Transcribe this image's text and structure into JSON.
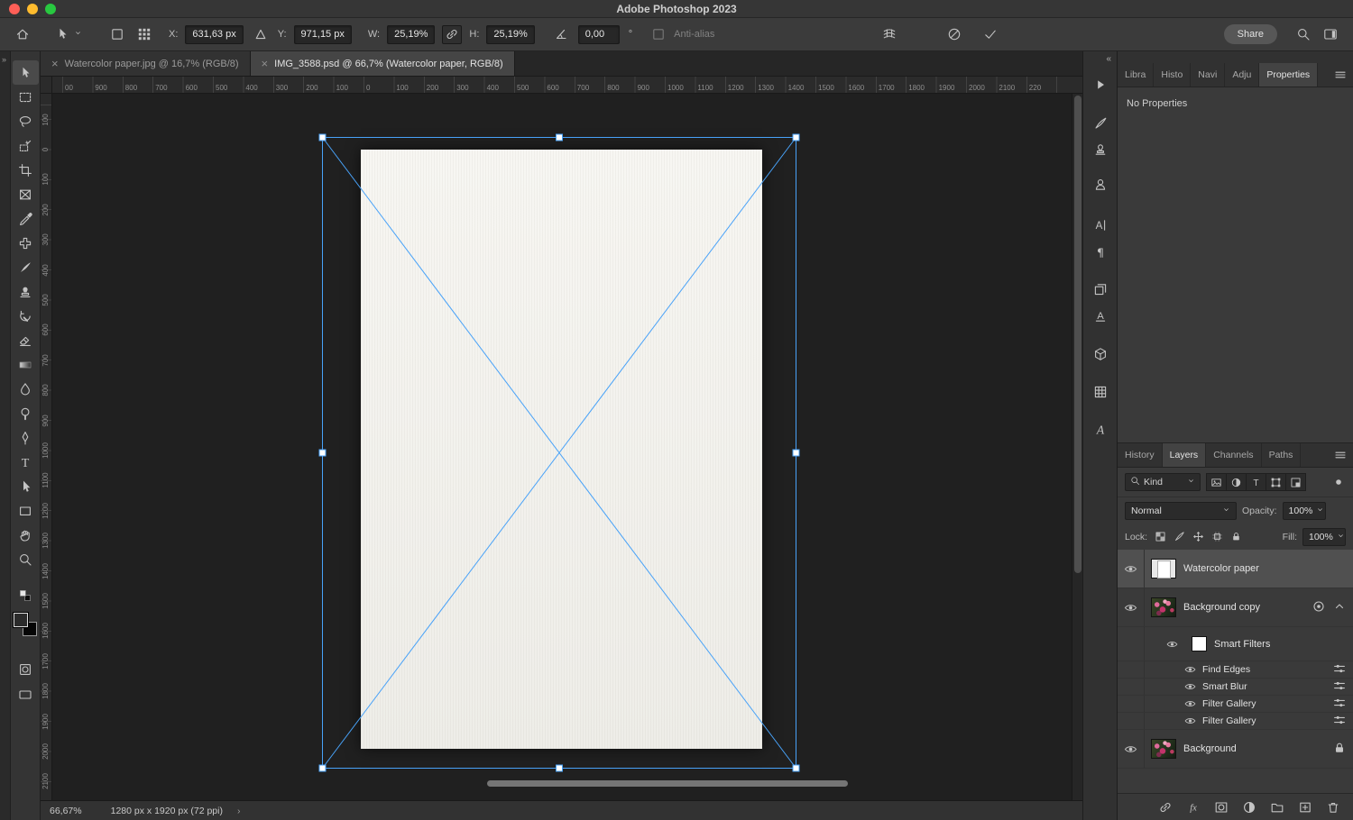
{
  "titlebar": {
    "title": "Adobe Photoshop 2023"
  },
  "colors": {
    "accent_blue": "#48a2f8",
    "traffic_red": "#ff5f57",
    "traffic_yellow": "#febc2e",
    "traffic_green": "#28c840",
    "selected_layer_bg": "#505050"
  },
  "options": {
    "fields": {
      "x_label": "X:",
      "x_value": "631,63 px",
      "y_label": "Y:",
      "y_value": "971,15 px",
      "w_label": "W:",
      "w_value": "25,19%",
      "h_label": "H:",
      "h_value": "25,19%",
      "angle_value": "0,00",
      "degree": "°"
    },
    "anti_alias_label": "Anti-alias",
    "share_label": "Share"
  },
  "doc_tabs": [
    {
      "label": "Watercolor paper.jpg @ 16,7% (RGB/8)",
      "active": false
    },
    {
      "label": "IMG_3588.psd @ 66,7% (Watercolor paper, RGB/8)",
      "active": true
    }
  ],
  "rulers": {
    "horizontal": [
      "00",
      "900",
      "800",
      "700",
      "600",
      "500",
      "400",
      "300",
      "200",
      "100",
      "0",
      "100",
      "200",
      "300",
      "400",
      "500",
      "600",
      "700",
      "800",
      "900",
      "1000",
      "1100",
      "1200",
      "1300",
      "1400",
      "1500",
      "1600",
      "1700",
      "1800",
      "1900",
      "2000",
      "2100",
      "220"
    ],
    "vertical": [
      "100",
      "0",
      "100",
      "200",
      "300",
      "400",
      "500",
      "600",
      "700",
      "800",
      "900",
      "1000",
      "1100",
      "1200",
      "1300",
      "1400",
      "1500",
      "1600",
      "1700",
      "1800",
      "1900",
      "2000",
      "2100"
    ]
  },
  "toolbar": {
    "collapse_glyph": "»",
    "tools": [
      "move-tool",
      "marquee-tool",
      "lasso-tool",
      "object-selection-tool",
      "crop-tool",
      "frame-tool",
      "eyedropper-tool",
      "healing-brush-tool",
      "brush-tool",
      "clone-stamp-tool",
      "history-brush-tool",
      "eraser-tool",
      "gradient-tool",
      "blur-tool",
      "dodge-tool",
      "pen-tool",
      "type-tool",
      "path-selection-tool",
      "shape-tool",
      "hand-tool",
      "zoom-tool"
    ]
  },
  "statusbar": {
    "zoom": "66,67%",
    "doc_info": "1280 px x 1920 px (72 ppi)",
    "chevron": "›"
  },
  "right_strip": {
    "collapse_glyph": "«",
    "icons": [
      "actions-panel-icon",
      "brush-settings-icon",
      "clone-source-icon",
      "tool-presets-icon",
      "character-panel-icon",
      "paragraph-panel-icon",
      "layer-comps-icon",
      "character-styles-icon",
      "3d-panel-icon",
      "patterns-panel-icon",
      "glyphs-panel-icon"
    ]
  },
  "panels": {
    "top_tabs": [
      {
        "label": "Libra",
        "active": false
      },
      {
        "label": "Histo",
        "active": false
      },
      {
        "label": "Navi",
        "active": false
      },
      {
        "label": "Adju",
        "active": false
      },
      {
        "label": "Properties",
        "active": true
      }
    ],
    "properties_empty": "No Properties",
    "layer_tabs": [
      {
        "label": "History",
        "active": false
      },
      {
        "label": "Layers",
        "active": true
      },
      {
        "label": "Channels",
        "active": false
      },
      {
        "label": "Paths",
        "active": false
      }
    ],
    "filter": {
      "kind_label": "Kind",
      "icons": [
        "pixel-layer-filter-icon",
        "adjustment-layer-filter-icon",
        "type-layer-filter-icon",
        "shape-layer-filter-icon",
        "smart-object-filter-icon"
      ]
    },
    "blend": {
      "mode": "Normal",
      "opacity_label": "Opacity:",
      "opacity_value": "100%"
    },
    "lock": {
      "label": "Lock:",
      "icons": [
        "lock-transparency-icon",
        "lock-pixels-icon",
        "lock-position-icon",
        "lock-artboard-icon",
        "lock-all-icon"
      ],
      "fill_label": "Fill:",
      "fill_value": "100%"
    },
    "layers": [
      {
        "type": "layer",
        "name": "Watercolor paper",
        "thumb": "paper",
        "selected": true,
        "visible": true
      },
      {
        "type": "layer",
        "name": "Background copy",
        "thumb": "flower",
        "selected": false,
        "visible": true,
        "smart_badge": true,
        "expander": true
      },
      {
        "type": "smart-filters",
        "name": "Smart Filters",
        "visible": true
      },
      {
        "type": "filter",
        "name": "Find Edges",
        "visible": true
      },
      {
        "type": "filter",
        "name": "Smart Blur",
        "visible": true
      },
      {
        "type": "filter",
        "name": "Filter Gallery",
        "visible": true
      },
      {
        "type": "filter",
        "name": "Filter Gallery",
        "visible": true
      },
      {
        "type": "layer",
        "name": "Background",
        "thumb": "flower",
        "selected": false,
        "visible": true,
        "locked": true
      }
    ],
    "footer_icons": [
      "link-layers-icon",
      "layer-style-icon",
      "layer-mask-icon",
      "adjustment-layer-icon",
      "new-group-icon",
      "new-layer-icon",
      "delete-layer-icon"
    ]
  }
}
